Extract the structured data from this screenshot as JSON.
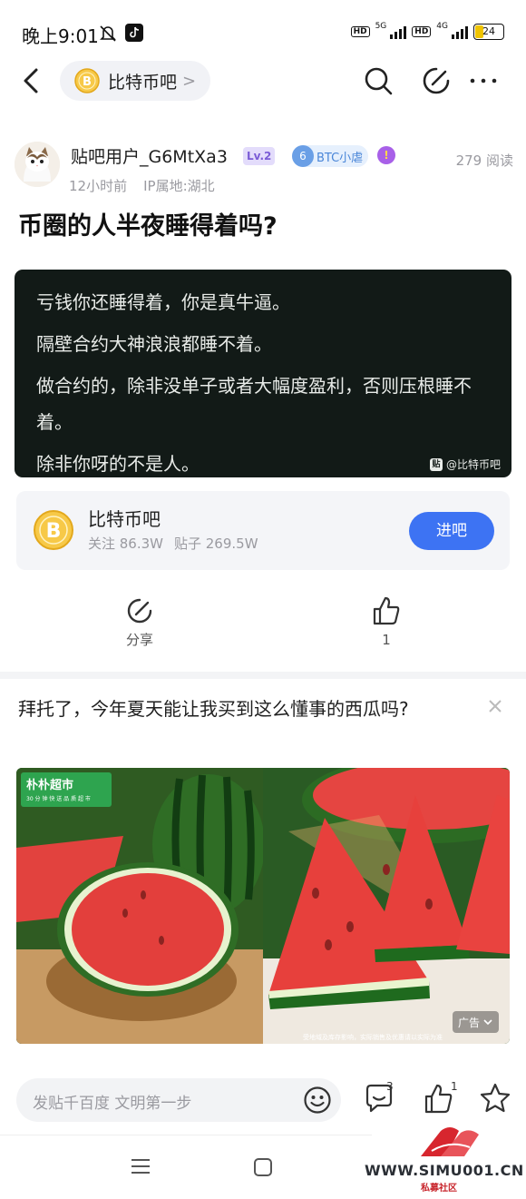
{
  "status_bar": {
    "time": "晚上9:01",
    "hd": "HD",
    "net1": "5G",
    "net2": "4G",
    "battery": "24"
  },
  "nav": {
    "forum_name": "比特币吧",
    "chevron": ">"
  },
  "post": {
    "username": "贴吧用户_G6MtXa3",
    "level": "Lv.2",
    "honor_num": "6",
    "honor_text": "BTC小虐",
    "read_count": "279 阅读",
    "time_ago": "12小时前",
    "ip_location": "IP属地:湖北",
    "title": "币圈的人半夜睡得着吗?",
    "image_lines": [
      "亏钱你还睡得着，你是真牛逼。",
      "隔壁合约大神浪浪都睡不着。",
      "做合约的，除非没单子或者大幅度盈利，否则压根睡不着。",
      "除非你呀的不是人。"
    ],
    "watermark": "@比特币吧"
  },
  "forum_card": {
    "name": "比特币吧",
    "followers": "关注 86.3W",
    "posts": "贴子 269.5W",
    "enter_label": "进吧"
  },
  "actions": {
    "share_label": "分享",
    "like_count": "1"
  },
  "ad": {
    "title": "拜托了，今年夏天能让我买到这么懂事的西瓜吗?",
    "brand": "朴朴超市",
    "brand_tagline": "30 分 钟 快 送 品 质 超 市",
    "badge": "广告",
    "disclaimer": "受地域及库存影响，实际销售及优惠请以实际为准"
  },
  "bottom_bar": {
    "reply_placeholder": "发贴千百度 文明第一步",
    "comment_count": "3",
    "like_count": "1"
  },
  "watermark_site": {
    "url": "WWW.SIMU001.CN",
    "sub": "私募社区"
  },
  "colors": {
    "accent": "#3d73f3",
    "level_badge": "#7b5cd6",
    "honor_badge": "#4a86d8"
  }
}
